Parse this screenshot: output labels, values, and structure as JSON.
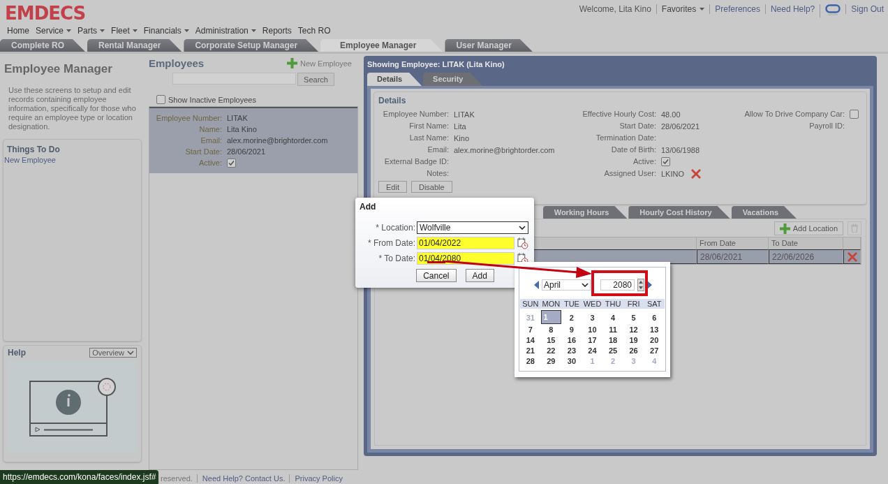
{
  "logo": "EMDECS",
  "top_links": [
    {
      "kind": "text",
      "label": "Welcome, Lita Kino"
    },
    {
      "kind": "menu",
      "label": "Favorites"
    },
    {
      "kind": "link",
      "label": "Preferences"
    },
    {
      "kind": "link",
      "label": "Need Help?"
    },
    {
      "kind": "icon"
    },
    {
      "kind": "link",
      "label": "Sign Out"
    }
  ],
  "menu": [
    {
      "label": "Home",
      "dropdown": false
    },
    {
      "label": "Service",
      "dropdown": true
    },
    {
      "label": "Parts",
      "dropdown": true
    },
    {
      "label": "Fleet",
      "dropdown": true
    },
    {
      "label": "Financials",
      "dropdown": true
    },
    {
      "label": "Administration",
      "dropdown": true
    },
    {
      "label": "Reports",
      "dropdown": false
    },
    {
      "label": "Tech RO",
      "dropdown": false
    }
  ],
  "app_tabs": [
    {
      "label": "Complete RO",
      "selected": false
    },
    {
      "label": "Rental Manager",
      "selected": false
    },
    {
      "label": "Corporate Setup Manager",
      "selected": false
    },
    {
      "label": "Employee Manager",
      "selected": true
    },
    {
      "label": "User Manager",
      "selected": false
    }
  ],
  "sidebar": {
    "title": "Employee Manager",
    "description": "Use these screens to setup and edit records containing employee information, specifically for those who require an employee type or location designation.",
    "todo": {
      "title": "Things To Do",
      "items": [
        "New Employee"
      ]
    },
    "help": {
      "title": "Help",
      "dropdown": "Overview"
    }
  },
  "employees": {
    "title": "Employees",
    "new_button": "New Employee",
    "search_button": "Search",
    "show_inactive": {
      "label": "Show Inactive Employees",
      "checked": false
    },
    "records": [
      {
        "selected": true,
        "fields": [
          {
            "kind": "text",
            "label": "Employee Number:",
            "value": "LITAK"
          },
          {
            "kind": "text",
            "label": "Name:",
            "value": "Lita Kino"
          },
          {
            "kind": "text",
            "label": "Email:",
            "value": "alex.morine@brightorder.com"
          },
          {
            "kind": "text",
            "label": "Start Date:",
            "value": "28/06/2021"
          },
          {
            "kind": "checkbox",
            "label": "Active:",
            "checked": true
          }
        ]
      }
    ]
  },
  "employee_panel": {
    "title": "Showing Employee: LITAK (Lita Kino)",
    "tabs": [
      {
        "label": "Details",
        "selected": true
      },
      {
        "label": "Security",
        "selected": false
      }
    ],
    "details": {
      "title": "Details",
      "columns": [
        [
          {
            "kind": "text",
            "label": "Employee Number:",
            "value": "LITAK"
          },
          {
            "kind": "text",
            "label": "First Name:",
            "value": "Lita"
          },
          {
            "kind": "text",
            "label": "Last Name:",
            "value": "Kino"
          },
          {
            "kind": "text",
            "label": "Email:",
            "value": "alex.morine@brightorder.com"
          },
          {
            "kind": "text",
            "label": "External Badge ID:"
          },
          {
            "kind": "text",
            "label": "Notes:"
          }
        ],
        [
          {
            "kind": "text",
            "label": "Effective Hourly Cost:",
            "value": "48.00"
          },
          {
            "kind": "text",
            "label": "Start Date:",
            "value": "28/06/2021"
          },
          {
            "kind": "text",
            "label": "Termination Date:"
          },
          {
            "kind": "text",
            "label": "Date of Birth:",
            "value": "13/06/1988"
          },
          {
            "kind": "checkbox",
            "label": "Active:",
            "checked": true
          },
          {
            "kind": "user",
            "label": "Assigned User:",
            "value": "LKINO"
          }
        ],
        [
          {
            "kind": "checkbox",
            "label": "Allow To Drive Company Car:",
            "checked": false
          },
          {
            "kind": "text",
            "label": "Payroll ID:"
          }
        ]
      ],
      "buttons": [
        "Edit",
        "Disable"
      ]
    },
    "sub_tabs": [
      {
        "label": "Working Hours",
        "selected": false
      },
      {
        "label": "Hourly Cost History",
        "selected": false
      },
      {
        "label": "Vacations",
        "selected": false
      }
    ],
    "add_button": "Add Location",
    "table": {
      "columns": [
        "From Date",
        "To Date"
      ],
      "rows": [
        {
          "selected": true,
          "cells": [
            "28/06/2021",
            "22/06/2026"
          ]
        }
      ]
    }
  },
  "dialog": {
    "title": "Add",
    "fields": [
      {
        "kind": "select",
        "label": "* Location:",
        "value": "Wolfville"
      },
      {
        "kind": "date",
        "label": "* From Date:",
        "value": "01/04/2022",
        "highlighted": true
      },
      {
        "kind": "date",
        "label": "* To Date:",
        "value": "01/04/2080",
        "highlighted": true
      }
    ],
    "buttons": [
      "Cancel",
      "Add"
    ]
  },
  "calendar": {
    "month": "April",
    "year": "2080",
    "weekdays": [
      "SUN",
      "MON",
      "TUE",
      "WED",
      "THU",
      "FRI",
      "SAT"
    ],
    "days": [
      {
        "day": "31",
        "other_month": true,
        "selected": false
      },
      {
        "day": "1",
        "other_month": false,
        "selected": true
      },
      {
        "day": "2",
        "other_month": false,
        "selected": false
      },
      {
        "day": "3",
        "other_month": false,
        "selected": false
      },
      {
        "day": "4",
        "other_month": false,
        "selected": false
      },
      {
        "day": "5",
        "other_month": false,
        "selected": false
      },
      {
        "day": "6",
        "other_month": false,
        "selected": false
      },
      {
        "day": "7",
        "other_month": false,
        "selected": false
      },
      {
        "day": "8",
        "other_month": false,
        "selected": false
      },
      {
        "day": "9",
        "other_month": false,
        "selected": false
      },
      {
        "day": "10",
        "other_month": false,
        "selected": false
      },
      {
        "day": "11",
        "other_month": false,
        "selected": false
      },
      {
        "day": "12",
        "other_month": false,
        "selected": false
      },
      {
        "day": "13",
        "other_month": false,
        "selected": false
      },
      {
        "day": "14",
        "other_month": false,
        "selected": false
      },
      {
        "day": "15",
        "other_month": false,
        "selected": false
      },
      {
        "day": "16",
        "other_month": false,
        "selected": false
      },
      {
        "day": "17",
        "other_month": false,
        "selected": false
      },
      {
        "day": "18",
        "other_month": false,
        "selected": false
      },
      {
        "day": "19",
        "other_month": false,
        "selected": false
      },
      {
        "day": "20",
        "other_month": false,
        "selected": false
      },
      {
        "day": "21",
        "other_month": false,
        "selected": false
      },
      {
        "day": "22",
        "other_month": false,
        "selected": false
      },
      {
        "day": "23",
        "other_month": false,
        "selected": false
      },
      {
        "day": "24",
        "other_month": false,
        "selected": false
      },
      {
        "day": "25",
        "other_month": false,
        "selected": false
      },
      {
        "day": "26",
        "other_month": false,
        "selected": false
      },
      {
        "day": "27",
        "other_month": false,
        "selected": false
      },
      {
        "day": "28",
        "other_month": false,
        "selected": false
      },
      {
        "day": "29",
        "other_month": false,
        "selected": false
      },
      {
        "day": "30",
        "other_month": false,
        "selected": false
      },
      {
        "day": "1",
        "other_month": true,
        "selected": false
      },
      {
        "day": "2",
        "other_month": true,
        "selected": false
      },
      {
        "day": "3",
        "other_month": true,
        "selected": false
      },
      {
        "day": "4",
        "other_month": true,
        "selected": false
      }
    ]
  },
  "footer": {
    "text": "reserved.",
    "links": [
      "Need Help? Contact Us.",
      "Privacy Policy"
    ]
  },
  "status_url": "https://emdecs.com/kona/faces/index.jsf#"
}
